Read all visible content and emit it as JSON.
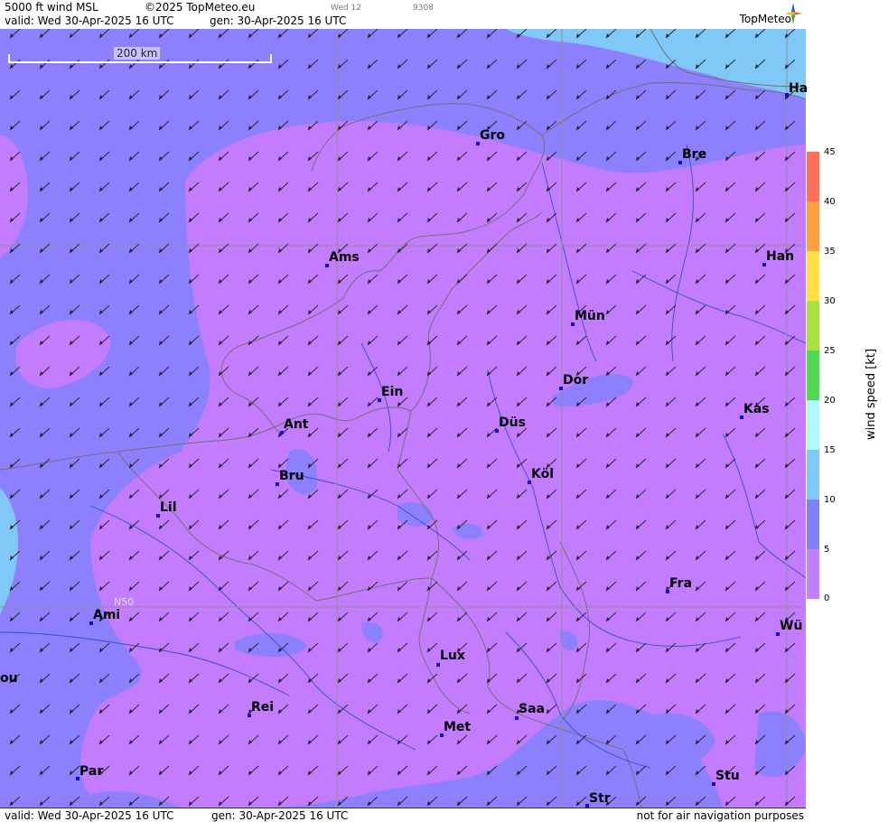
{
  "header": {
    "product": "5000 ft wind MSL",
    "copyright": "©2025 TopMeteo.eu",
    "small_day": "Wed 12",
    "small_code": "9308",
    "valid": "valid:  Wed  30-Apr-2025  16 UTC",
    "gen": "gen: 30-Apr-2025 16 UTC",
    "brand": "TopMeteo"
  },
  "footer": {
    "valid": "valid:  Wed  30-Apr-2025  16 UTC",
    "gen": "gen: 30-Apr-2025 16 UTC",
    "disclaimer": "not for air navigation purposes"
  },
  "scale": {
    "label": "200 km"
  },
  "latitude_label": "N50",
  "legend": {
    "title": "wind  speed  [kt]",
    "ticks": [
      "45",
      "40",
      "35",
      "30",
      "25",
      "20",
      "15",
      "10",
      "5",
      "0"
    ],
    "colors": [
      "#ff6f5a",
      "#ffa040",
      "#ffe040",
      "#a8e040",
      "#50d850",
      "#b0f8ff",
      "#80c8f8",
      "#8080ff",
      "#c080ff"
    ]
  },
  "cities": [
    {
      "name": "Gro"
    },
    {
      "name": "Bre"
    },
    {
      "name": "Ha"
    },
    {
      "name": "Ams"
    },
    {
      "name": "Han"
    },
    {
      "name": "Mün"
    },
    {
      "name": "Ein"
    },
    {
      "name": "Dor"
    },
    {
      "name": "Ant"
    },
    {
      "name": "Düs"
    },
    {
      "name": "Kas"
    },
    {
      "name": "Bru"
    },
    {
      "name": "Köl"
    },
    {
      "name": "Lil"
    },
    {
      "name": "Fra"
    },
    {
      "name": "Ami"
    },
    {
      "name": "Wü"
    },
    {
      "name": "Lux"
    },
    {
      "name": "ou"
    },
    {
      "name": "Rei"
    },
    {
      "name": "Saa"
    },
    {
      "name": "Met"
    },
    {
      "name": "Par"
    },
    {
      "name": "Stu"
    },
    {
      "name": "Str"
    }
  ]
}
